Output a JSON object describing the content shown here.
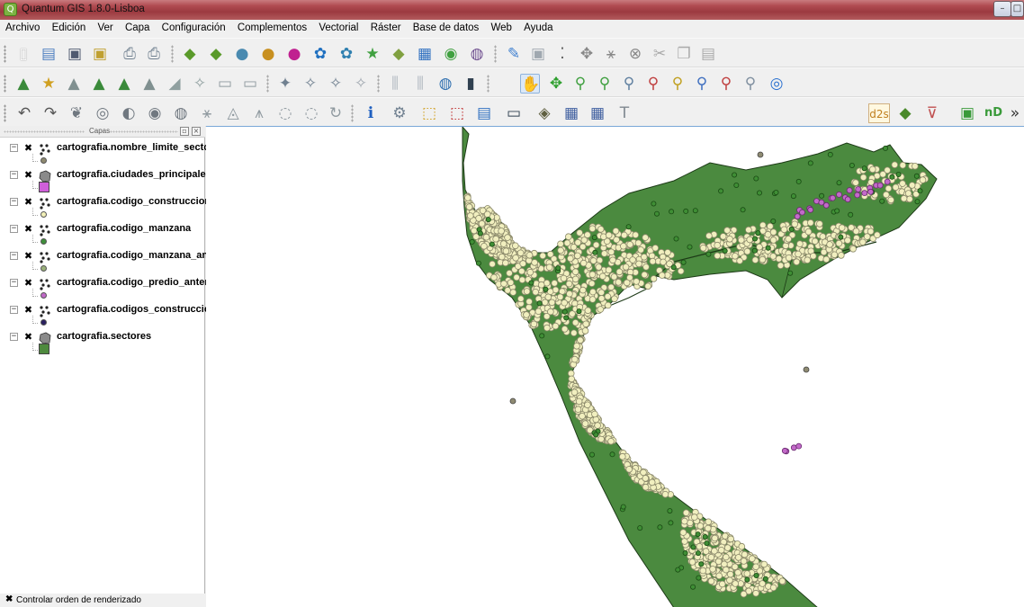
{
  "window": {
    "title": "Quantum GIS 1.8.0-Lisboa",
    "app_icon": "qgis-icon"
  },
  "menu": {
    "items": [
      "Archivo",
      "Edición",
      "Ver",
      "Capa",
      "Configuración",
      "Complementos",
      "Vectorial",
      "Ráster",
      "Base de datos",
      "Web",
      "Ayuda"
    ]
  },
  "toolbars": {
    "row1_icons": [
      "new-project-icon",
      "open-project-icon",
      "save-project-icon",
      "save-as-icon",
      "print-composer-icon",
      "composer-manager-icon",
      "add-vector-layer-icon",
      "add-raster-layer-icon",
      "add-postgis-layer-icon",
      "add-spatialite-layer-icon",
      "add-mssql-layer-icon",
      "add-wms-layer-icon",
      "add-wcs-layer-icon",
      "add-wfs-layer-icon",
      "new-vector-layer-icon",
      "new-spatialite-layer-icon",
      "toggle-editing-icon",
      "save-edits-icon",
      "add-feature-icon",
      "move-feature-icon",
      "node-tool-icon",
      "delete-selected-icon",
      "cut-features-icon",
      "copy-features-icon",
      "paste-features-icon"
    ],
    "row2_icons": [
      "style-manager-icon",
      "bookmark-icon",
      "measure-icon",
      "attribute-table-icon",
      "field-calculator-icon",
      "statistics-icon",
      "label-tool-icon",
      "tips-icon",
      "map-tips-icon",
      "georeferencer-icon",
      "gps-icon",
      "graph-icon",
      "plugin-icon",
      "raster-calc-icon",
      "pan-icon",
      "pan-to-selection-icon",
      "zoom-in-icon",
      "zoom-out-icon",
      "zoom-full-icon",
      "zoom-to-selection-icon",
      "zoom-to-layer-icon",
      "zoom-last-icon",
      "zoom-next-icon",
      "zoom-native-icon",
      "refresh-icon"
    ],
    "row3_icons": [
      "undo-icon",
      "redo-icon",
      "simplify-icon",
      "add-ring-icon",
      "add-part-icon",
      "delete-ring-icon",
      "delete-part-icon",
      "reshape-icon",
      "offset-curve-icon",
      "split-features-icon",
      "merge-features-icon",
      "merge-attributes-icon",
      "rotate-point-icon",
      "identify-icon",
      "action-icon",
      "select-features-icon",
      "deselect-icon",
      "attribute-table-small-icon",
      "measure-line-icon",
      "annotation-icon",
      "map-tip-icon",
      "map-tip-home-icon",
      "text-annotation-icon"
    ],
    "row3_right_icons": [
      "d2s-icon",
      "python-icon",
      "vector-filter-icon",
      "nd-icon",
      "toolbar-overflow-icon"
    ],
    "d2s_label": "d2s",
    "nd_label": "nD"
  },
  "layers_panel": {
    "title": "Capas",
    "layers": [
      {
        "name": "cartografia.nombre_limite_sector",
        "type": "point",
        "symbol_color": "#8f8a70"
      },
      {
        "name": "cartografia.ciudades_principales",
        "type": "polygon",
        "symbol_color": "#cf5fd9"
      },
      {
        "name": "cartografia.codigo_construccion",
        "type": "point",
        "symbol_color": "#f2f0b8"
      },
      {
        "name": "cartografia.codigo_manzana",
        "type": "point",
        "symbol_color": "#3f8f3a"
      },
      {
        "name": "cartografia.codigo_manzana_ante...",
        "type": "point",
        "symbol_color": "#9ab07a"
      },
      {
        "name": "cartografia.codigo_predio_anterior",
        "type": "point",
        "symbol_color": "#c068c8"
      },
      {
        "name": "cartografia.codigos_construccion",
        "type": "point",
        "symbol_color": "#2a2060"
      },
      {
        "name": "cartografia.sectores",
        "type": "polygon",
        "symbol_color": "#4e8a3e"
      }
    ],
    "render_order_label": "Controlar orden de renderizado"
  },
  "map": {
    "sector_fill": "#4b8a3f",
    "sector_stroke": "#1d3a17",
    "construction_fill": "#f1efbf",
    "construction_stroke": "#8a886a",
    "block_fill": "#3f8e35",
    "predio_fill": "#c36ac9",
    "limit_fill": "#8f8b72"
  }
}
